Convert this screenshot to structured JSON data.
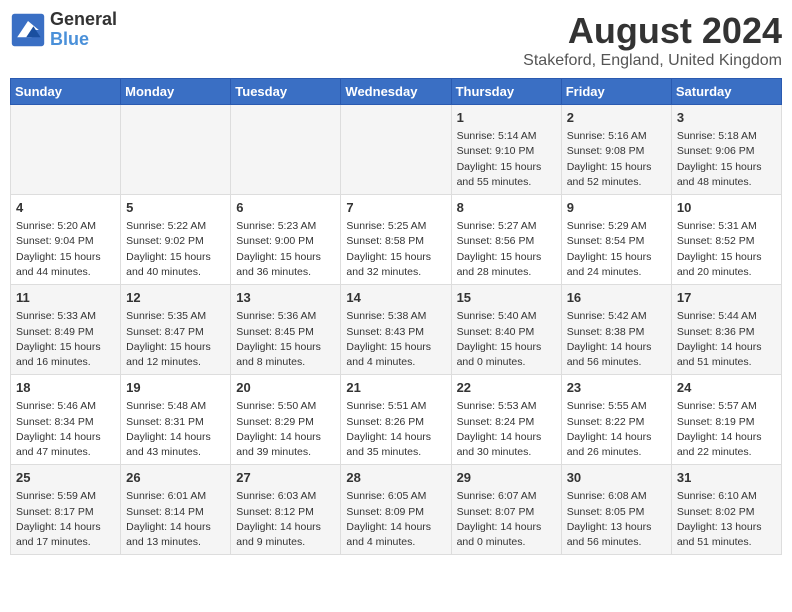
{
  "header": {
    "logo_line1": "General",
    "logo_line2": "Blue",
    "main_title": "August 2024",
    "subtitle": "Stakeford, England, United Kingdom"
  },
  "weekdays": [
    "Sunday",
    "Monday",
    "Tuesday",
    "Wednesday",
    "Thursday",
    "Friday",
    "Saturday"
  ],
  "weeks": [
    [
      {
        "day": "",
        "info": ""
      },
      {
        "day": "",
        "info": ""
      },
      {
        "day": "",
        "info": ""
      },
      {
        "day": "",
        "info": ""
      },
      {
        "day": "1",
        "info": "Sunrise: 5:14 AM\nSunset: 9:10 PM\nDaylight: 15 hours\nand 55 minutes."
      },
      {
        "day": "2",
        "info": "Sunrise: 5:16 AM\nSunset: 9:08 PM\nDaylight: 15 hours\nand 52 minutes."
      },
      {
        "day": "3",
        "info": "Sunrise: 5:18 AM\nSunset: 9:06 PM\nDaylight: 15 hours\nand 48 minutes."
      }
    ],
    [
      {
        "day": "4",
        "info": "Sunrise: 5:20 AM\nSunset: 9:04 PM\nDaylight: 15 hours\nand 44 minutes."
      },
      {
        "day": "5",
        "info": "Sunrise: 5:22 AM\nSunset: 9:02 PM\nDaylight: 15 hours\nand 40 minutes."
      },
      {
        "day": "6",
        "info": "Sunrise: 5:23 AM\nSunset: 9:00 PM\nDaylight: 15 hours\nand 36 minutes."
      },
      {
        "day": "7",
        "info": "Sunrise: 5:25 AM\nSunset: 8:58 PM\nDaylight: 15 hours\nand 32 minutes."
      },
      {
        "day": "8",
        "info": "Sunrise: 5:27 AM\nSunset: 8:56 PM\nDaylight: 15 hours\nand 28 minutes."
      },
      {
        "day": "9",
        "info": "Sunrise: 5:29 AM\nSunset: 8:54 PM\nDaylight: 15 hours\nand 24 minutes."
      },
      {
        "day": "10",
        "info": "Sunrise: 5:31 AM\nSunset: 8:52 PM\nDaylight: 15 hours\nand 20 minutes."
      }
    ],
    [
      {
        "day": "11",
        "info": "Sunrise: 5:33 AM\nSunset: 8:49 PM\nDaylight: 15 hours\nand 16 minutes."
      },
      {
        "day": "12",
        "info": "Sunrise: 5:35 AM\nSunset: 8:47 PM\nDaylight: 15 hours\nand 12 minutes."
      },
      {
        "day": "13",
        "info": "Sunrise: 5:36 AM\nSunset: 8:45 PM\nDaylight: 15 hours\nand 8 minutes."
      },
      {
        "day": "14",
        "info": "Sunrise: 5:38 AM\nSunset: 8:43 PM\nDaylight: 15 hours\nand 4 minutes."
      },
      {
        "day": "15",
        "info": "Sunrise: 5:40 AM\nSunset: 8:40 PM\nDaylight: 15 hours\nand 0 minutes."
      },
      {
        "day": "16",
        "info": "Sunrise: 5:42 AM\nSunset: 8:38 PM\nDaylight: 14 hours\nand 56 minutes."
      },
      {
        "day": "17",
        "info": "Sunrise: 5:44 AM\nSunset: 8:36 PM\nDaylight: 14 hours\nand 51 minutes."
      }
    ],
    [
      {
        "day": "18",
        "info": "Sunrise: 5:46 AM\nSunset: 8:34 PM\nDaylight: 14 hours\nand 47 minutes."
      },
      {
        "day": "19",
        "info": "Sunrise: 5:48 AM\nSunset: 8:31 PM\nDaylight: 14 hours\nand 43 minutes."
      },
      {
        "day": "20",
        "info": "Sunrise: 5:50 AM\nSunset: 8:29 PM\nDaylight: 14 hours\nand 39 minutes."
      },
      {
        "day": "21",
        "info": "Sunrise: 5:51 AM\nSunset: 8:26 PM\nDaylight: 14 hours\nand 35 minutes."
      },
      {
        "day": "22",
        "info": "Sunrise: 5:53 AM\nSunset: 8:24 PM\nDaylight: 14 hours\nand 30 minutes."
      },
      {
        "day": "23",
        "info": "Sunrise: 5:55 AM\nSunset: 8:22 PM\nDaylight: 14 hours\nand 26 minutes."
      },
      {
        "day": "24",
        "info": "Sunrise: 5:57 AM\nSunset: 8:19 PM\nDaylight: 14 hours\nand 22 minutes."
      }
    ],
    [
      {
        "day": "25",
        "info": "Sunrise: 5:59 AM\nSunset: 8:17 PM\nDaylight: 14 hours\nand 17 minutes."
      },
      {
        "day": "26",
        "info": "Sunrise: 6:01 AM\nSunset: 8:14 PM\nDaylight: 14 hours\nand 13 minutes."
      },
      {
        "day": "27",
        "info": "Sunrise: 6:03 AM\nSunset: 8:12 PM\nDaylight: 14 hours\nand 9 minutes."
      },
      {
        "day": "28",
        "info": "Sunrise: 6:05 AM\nSunset: 8:09 PM\nDaylight: 14 hours\nand 4 minutes."
      },
      {
        "day": "29",
        "info": "Sunrise: 6:07 AM\nSunset: 8:07 PM\nDaylight: 14 hours\nand 0 minutes."
      },
      {
        "day": "30",
        "info": "Sunrise: 6:08 AM\nSunset: 8:05 PM\nDaylight: 13 hours\nand 56 minutes."
      },
      {
        "day": "31",
        "info": "Sunrise: 6:10 AM\nSunset: 8:02 PM\nDaylight: 13 hours\nand 51 minutes."
      }
    ]
  ]
}
